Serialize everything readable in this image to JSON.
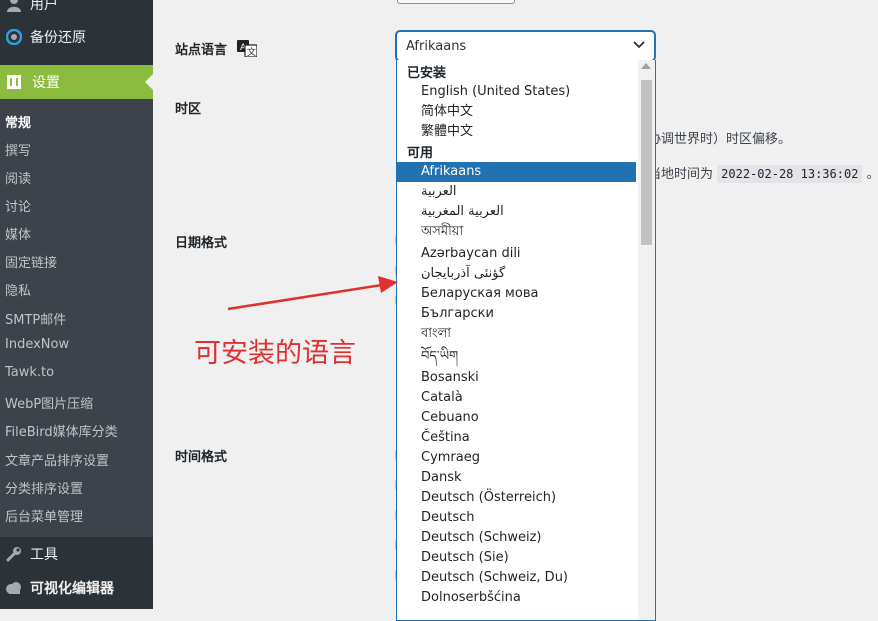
{
  "sidebar": {
    "top_items": [
      {
        "label": "用户",
        "icon": "user-icon"
      },
      {
        "label": "备份还原",
        "icon": "backup-icon"
      }
    ],
    "active": {
      "label": "设置",
      "icon": "settings-icon"
    },
    "submenu": [
      "常规",
      "撰写",
      "阅读",
      "讨论",
      "媒体",
      "固定链接",
      "隐私",
      "SMTP邮件",
      "IndexNow",
      "Tawk.to",
      "WebP图片压缩",
      "FileBird媒体库分类",
      "文章产品排序设置",
      "分类排序设置",
      "后台菜单管理"
    ],
    "bottom_items": [
      {
        "label": "工具",
        "icon": "wrench-icon"
      },
      {
        "label": "可视化编辑器",
        "icon": "cloud-icon"
      }
    ]
  },
  "settings": {
    "site_language_label": "站点语言",
    "site_language_value": "Afrikaans",
    "timezone_label": "时区",
    "timezone_desc": "协调世界时）时区偏移。",
    "local_time_prefix": "当地时间为",
    "local_time_value": "2022-02-28 13:36:02",
    "local_time_suffix": "。",
    "date_format_label": "日期格式",
    "time_format_label": "时间格式"
  },
  "dropdown": {
    "installed_group": "已安装",
    "installed": [
      "English (United States)",
      "简体中文",
      "繁體中文"
    ],
    "available_group": "可用",
    "available": [
      "Afrikaans",
      "العربية",
      "العربية المغربية",
      "অসমীয়া",
      "Azərbaycan dili",
      "گؤنئی آذربایجان",
      "Беларуская мова",
      "Български",
      "বাংলা",
      "བོད་ཡིག",
      "Bosanski",
      "Català",
      "Cebuano",
      "Čeština",
      "Cymraeg",
      "Dansk",
      "Deutsch (Österreich)",
      "Deutsch",
      "Deutsch (Schweiz)",
      "Deutsch (Sie)",
      "Deutsch (Schweiz, Du)",
      "Dolnoserbšćina"
    ],
    "selected": "Afrikaans"
  },
  "annotation": {
    "text": "可安装的语言",
    "color": "#e03131"
  },
  "colors": {
    "accent": "#2271b1",
    "sidebar_active": "#8bbb3f",
    "sidebar_bg": "#2c3338"
  }
}
